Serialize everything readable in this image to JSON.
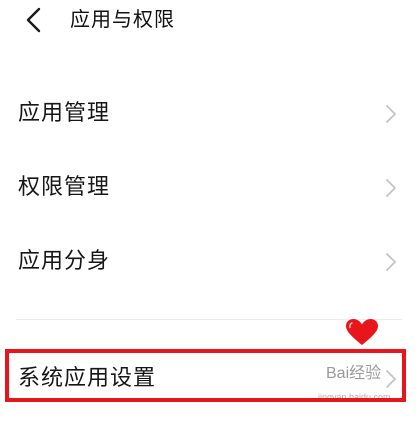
{
  "header": {
    "back_icon": "chevron-left-icon",
    "title": "应用与权限"
  },
  "items": [
    {
      "label": "应用管理",
      "icon": "chevron-right-icon"
    },
    {
      "label": "权限管理",
      "icon": "chevron-right-icon"
    },
    {
      "label": "应用分身",
      "icon": "chevron-right-icon"
    },
    {
      "label": "系统应用设置",
      "icon": "chevron-right-icon"
    }
  ],
  "annotation": {
    "highlight_color": "#e8161a",
    "heart_color": "#e8161a",
    "heart_icon": "heart-icon"
  },
  "watermark": {
    "text": "Bai经验",
    "url": "jingyan.baidu.com"
  },
  "colors": {
    "background": "#ffffff",
    "text": "#161616",
    "chevron": "#c4c4c4",
    "divider": "#ececec"
  }
}
